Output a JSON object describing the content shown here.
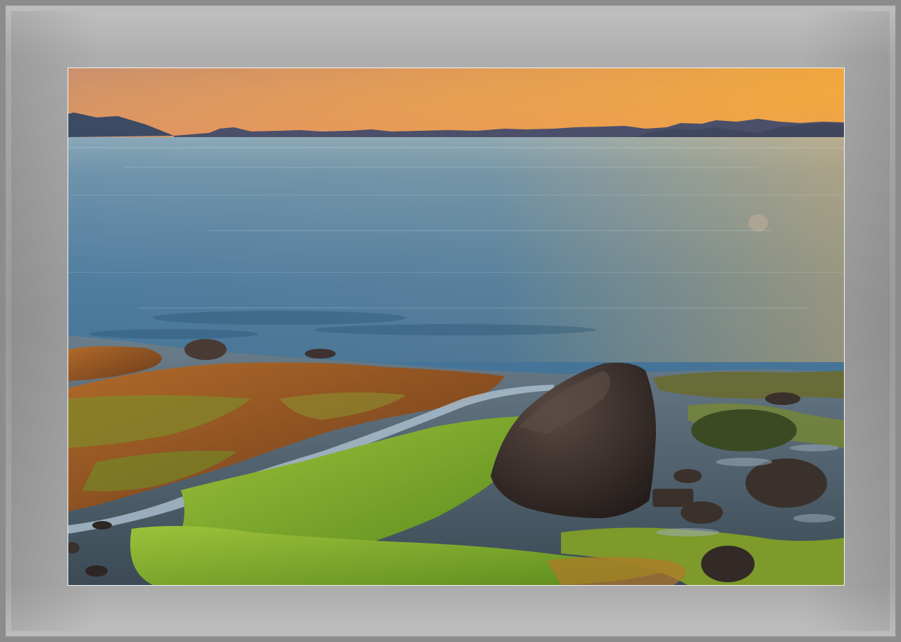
{
  "image": {
    "subject": "sunset-seascape",
    "colors": {
      "frame": "#9a9a9a",
      "mat_border": "#f2f2f2",
      "sky_top": "#e8a24a",
      "sky_horizon": "#d8985a",
      "water": "#4f7fa0",
      "moss": "#7aa82a",
      "seaweed": "#a0582a",
      "rock": "#3a302c"
    }
  }
}
